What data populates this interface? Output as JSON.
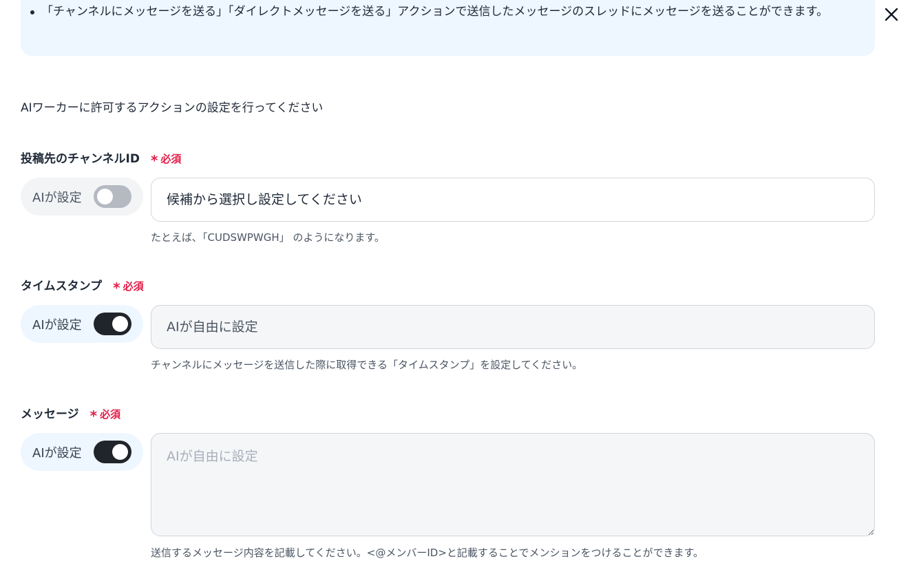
{
  "info": {
    "bullet": "「チャンネルにメッセージを送る」「ダイレクトメッセージを送る」アクションで送信したメッセージのスレッドにメッセージを送ることができます。"
  },
  "intro": "AIワーカーに許可するアクションの設定を行ってください",
  "required_label": "必須",
  "required_mark": "*",
  "fields": [
    {
      "label": "投稿先のチャンネルID",
      "ai_label": "AIが設定",
      "ai_enabled": false,
      "placeholder": "候補から選択し設定してください",
      "hint": "たとえば､「CUDSWPWGH」 のようになります。"
    },
    {
      "label": "タイムスタンプ",
      "ai_label": "AIが設定",
      "ai_enabled": true,
      "placeholder": "AIが自由に設定",
      "hint": "チャンネルにメッセージを送信した際に取得できる「タイムスタンプ」を設定してください。"
    },
    {
      "label": "メッセージ",
      "ai_label": "AIが設定",
      "ai_enabled": true,
      "placeholder": "AIが自由に設定",
      "hint": "送信するメッセージ内容を記載してください。<@メンバーID>と記載することでメンションをつけることができます。"
    }
  ],
  "icons": {
    "close": "close-icon"
  },
  "colors": {
    "required": "#e11d48",
    "toggle_on": "#20242b",
    "toggle_off": "#b4b9c2",
    "info_bg": "#eef6ff"
  }
}
